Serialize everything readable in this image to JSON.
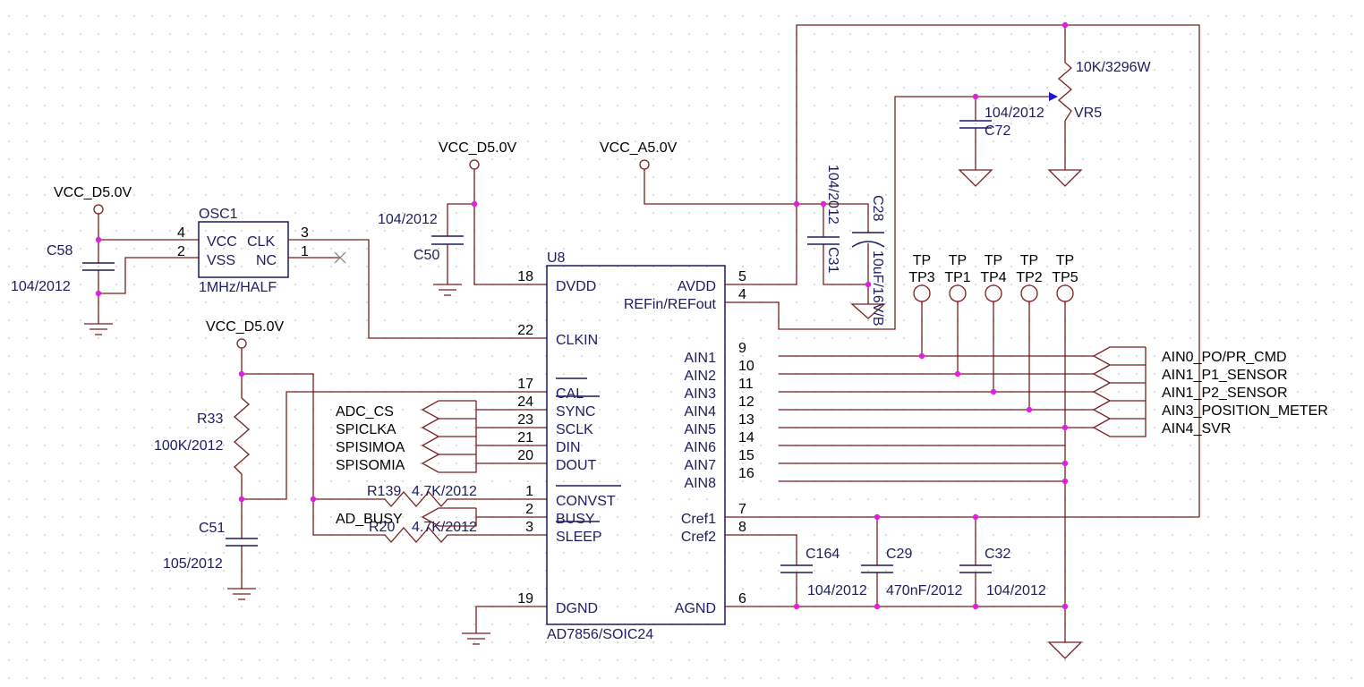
{
  "power": {
    "vcc_d5": "VCC_D5.0V",
    "vcc_a5": "VCC_A5.0V"
  },
  "u8": {
    "ref": "U8",
    "part": "AD7856/SOIC24",
    "left_pins": [
      {
        "name": "DVDD",
        "num": "18"
      },
      {
        "name": "CLKIN",
        "num": "22"
      },
      {
        "name": "CAL",
        "num": "17"
      },
      {
        "name": "SYNC",
        "num": "24"
      },
      {
        "name": "SCLK",
        "num": "23"
      },
      {
        "name": "DIN",
        "num": "21"
      },
      {
        "name": "DOUT",
        "num": "20"
      },
      {
        "name": "CONVST",
        "num": "1"
      },
      {
        "name": "BUSY",
        "num": "2"
      },
      {
        "name": "SLEEP",
        "num": "3"
      },
      {
        "name": "DGND",
        "num": "19"
      }
    ],
    "right_pins": [
      {
        "name": "AVDD",
        "num": "5"
      },
      {
        "name": "REFin/REFout",
        "num": "4"
      },
      {
        "name": "AIN1",
        "num": "9"
      },
      {
        "name": "AIN2",
        "num": "10"
      },
      {
        "name": "AIN3",
        "num": "11"
      },
      {
        "name": "AIN4",
        "num": "12"
      },
      {
        "name": "AIN5",
        "num": "13"
      },
      {
        "name": "AIN6",
        "num": "14"
      },
      {
        "name": "AIN7",
        "num": "15"
      },
      {
        "name": "AIN8",
        "num": "16"
      },
      {
        "name": "Cref1",
        "num": "7"
      },
      {
        "name": "Cref2",
        "num": "8"
      },
      {
        "name": "AGND",
        "num": "6"
      }
    ]
  },
  "osc1": {
    "ref": "OSC1",
    "value": "1MHz/HALF",
    "pin_vcc": "VCC",
    "pin_vss": "VSS",
    "pin_clk": "CLK",
    "pin_nc": "NC",
    "num_vcc": "4",
    "num_vss": "2",
    "num_clk": "3",
    "num_nc": "1"
  },
  "components": {
    "c58": {
      "ref": "C58",
      "value": "104/2012"
    },
    "c50": {
      "ref": "C50",
      "value": "104/2012"
    },
    "r33": {
      "ref": "R33",
      "value": "100K/2012"
    },
    "c51": {
      "ref": "C51",
      "value": "105/2012"
    },
    "r139": {
      "ref": "R139",
      "value": "4.7K/2012"
    },
    "r20": {
      "ref": "R20",
      "value": "4.7K/2012"
    },
    "c31": {
      "ref": "C31",
      "value": "104/2012"
    },
    "c28": {
      "ref": "C28",
      "value": "10uF/16V/B"
    },
    "c72": {
      "ref": "C72",
      "value": "104/2012"
    },
    "vr5": {
      "ref": "VR5",
      "value": "10K/3296W"
    },
    "c164": {
      "ref": "C164",
      "value": "104/2012"
    },
    "c29": {
      "ref": "C29",
      "value": "470nF/2012"
    },
    "c32": {
      "ref": "C32",
      "value": "104/2012"
    }
  },
  "test_points": [
    {
      "type": "TP",
      "ref": "TP3"
    },
    {
      "type": "TP",
      "ref": "TP1"
    },
    {
      "type": "TP",
      "ref": "TP4"
    },
    {
      "type": "TP",
      "ref": "TP2"
    },
    {
      "type": "TP",
      "ref": "TP5"
    }
  ],
  "left_ports": [
    "ADC_CS",
    "SPICLKA",
    "SPISIMOA",
    "SPISOMIA",
    "AD_BUSY"
  ],
  "right_ports": [
    "AIN0_PO/PR_CMD",
    "AIN1_P1_SENSOR",
    "AIN1_P2_SENSOR",
    "AIN3_POSITION_METER",
    "AIN4_SVR"
  ],
  "colors": {
    "wire": "#7a1f1f",
    "part": "#1c1c5c",
    "junction": "#e020e0"
  }
}
